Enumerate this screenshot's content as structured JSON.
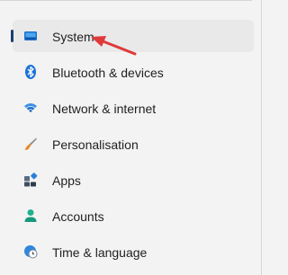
{
  "nav": {
    "items": [
      {
        "label": "System",
        "icon": "monitor-icon",
        "selected": true
      },
      {
        "label": "Bluetooth & devices",
        "icon": "bluetooth-icon"
      },
      {
        "label": "Network & internet",
        "icon": "wifi-icon"
      },
      {
        "label": "Personalisation",
        "icon": "paintbrush-icon"
      },
      {
        "label": "Apps",
        "icon": "apps-icon"
      },
      {
        "label": "Accounts",
        "icon": "person-icon"
      },
      {
        "label": "Time & language",
        "icon": "globe-clock-icon"
      }
    ]
  },
  "colors": {
    "accent": "#1b3f73",
    "annotation_arrow": "#e0393b"
  }
}
